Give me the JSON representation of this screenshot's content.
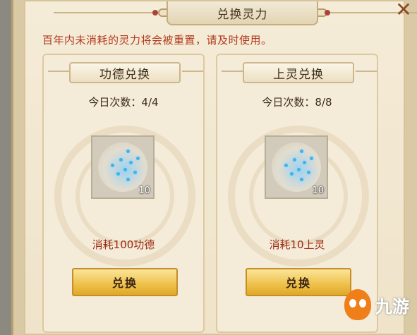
{
  "dialog": {
    "title": "兑换灵力",
    "close_label": "✕",
    "notice": "百年内未消耗的灵力将会被重置，请及时使用。"
  },
  "cards": [
    {
      "header": "功德兑换",
      "count": "今日次数：4/4",
      "item_qty": "10",
      "cost": "消耗100功德",
      "button": "兑换"
    },
    {
      "header": "上灵兑换",
      "count": "今日次数：8/8",
      "item_qty": "10",
      "cost": "消耗10上灵",
      "button": "兑换"
    }
  ],
  "watermark": {
    "text": "九游"
  }
}
